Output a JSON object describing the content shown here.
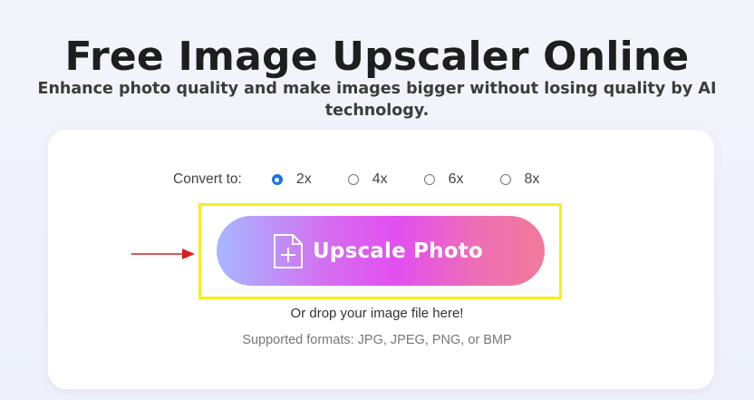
{
  "header": {
    "title": "Free Image Upscaler Online",
    "subtitle": "Enhance photo quality and make images bigger without losing quality by AI technology."
  },
  "converter": {
    "label": "Convert to:",
    "options": [
      {
        "label": "2x",
        "selected": true
      },
      {
        "label": "4x",
        "selected": false
      },
      {
        "label": "6x",
        "selected": false
      },
      {
        "label": "8x",
        "selected": false
      }
    ]
  },
  "upload": {
    "button_label": "Upscale Photo",
    "button_icon": "file-plus-icon",
    "drop_text": "Or drop your image file here!",
    "formats_text": "Supported formats: JPG, JPEG, PNG, or BMP"
  },
  "annotations": {
    "highlight_color": "#f7ef1a",
    "arrow_color": "#d42020"
  },
  "colors": {
    "button_gradient": [
      "#a7b8ff",
      "#e24ff0",
      "#f27a9a"
    ],
    "radio_selected": "#1a73e8"
  }
}
